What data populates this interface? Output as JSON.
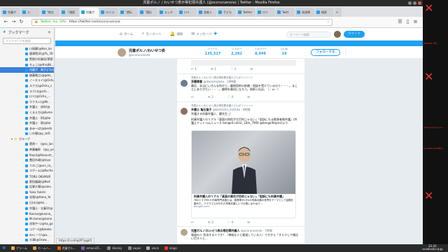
{
  "window": {
    "title": "児童ポルノ / わいせつ表示等犯罪弁護人 (@ocoruruenoia) | Twitter - Mozilla Firefox"
  },
  "tabs": [
    {
      "label": "児童ポ",
      "active": false
    },
    {
      "label": "ジ",
      "active": false
    },
    {
      "label": "\"地方",
      "active": false
    },
    {
      "label": "「顔面",
      "active": false
    },
    {
      "label": "児童ポ",
      "active": true
    },
    {
      "label": "ロリコ",
      "active": false
    },
    {
      "label": "\"遺伝",
      "active": false
    },
    {
      "label": "\"遺伝",
      "active": false
    },
    {
      "label": "エッチ",
      "active": false
    },
    {
      "label": "ロリ",
      "active": false
    },
    {
      "label": "芸能人",
      "active": false
    },
    {
      "label": "子ども",
      "active": false
    },
    {
      "label": "Twitter",
      "active": false
    },
    {
      "label": "ロリ",
      "active": false
    },
    {
      "label": "Twitt",
      "active": false
    },
    {
      "label": "発達障",
      "active": false
    },
    {
      "label": "検索",
      "active": false
    }
  ],
  "nav": {
    "back_icon": "arrow-left-icon",
    "forward_icon": "arrow-right-icon",
    "reload_icon": "reload-icon",
    "url_org": "Twitter, Inc. (US)",
    "url": "https://twitter.com/ocoruruenoia"
  },
  "sidebar": {
    "title": "ブックマーク",
    "search_placeholder": "ブックマークを検索",
    "items": [
      {
        "label": "川岡慶(@Ken_ka",
        "selected": false
      },
      {
        "label": "唐澤貴洋(@Ta_ Dt",
        "selected": false
      },
      {
        "label": "警察庁刑事局(警察",
        "selected": false
      },
      {
        "label": "ちょこ(@dhrqNl...",
        "selected": false
      },
      {
        "label": "児童ポ　岡子ども(@",
        "selected": true
      },
      {
        "label": "後藤雅之(@goto_",
        "selected": false
      },
      {
        "label": "ノースライ(@Ochu",
        "selected": false
      },
      {
        "label": "スクろ(@Ochu_s",
        "selected": false
      },
      {
        "label": "スクロ(@ichi...",
        "selected": false
      },
      {
        "label": "ロリ(@Ochu_...",
        "selected": false
      },
      {
        "label": "ホクスシ(@Mr...",
        "selected": false
      },
      {
        "label": "弁護士 · 成年(@",
        "selected": false
      },
      {
        "label": "くまえち(@Kuma",
        "selected": false
      },
      {
        "label": "弁護士 · 刑(@ba",
        "selected": false
      },
      {
        "label": "弁護士 · 敦(@ba",
        "selected": false
      },
      {
        "label": "あみーば(@beshi",
        "selected": false
      },
      {
        "label": "いわ猫(@y_iaIG",
        "selected": false
      }
    ],
    "group_label": "グループ",
    "group_items": [
      {
        "label": "菅原ー　(@ss_lan"
      },
      {
        "label": "斉藤義郎　(@y_ya"
      },
      {
        "label": "Kayo(@Kaeyum_"
      },
      {
        "label": "豊田市政(@toyo"
      },
      {
        "label": "うのこ(@uni_co_"
      },
      {
        "label": "ラボーム(@Kucha"
      },
      {
        "label": "TORU OKUMUR"
      },
      {
        "label": "野田議員(@Nod"
      },
      {
        "label": "記事大事(@suku"
      },
      {
        "label": "Yuka Yukimi"
      },
      {
        "label": "花咲(@Hana_Ya"
      },
      {
        "label": "日(の)@Hsi..."
      },
      {
        "label": "弁護士 · 五藤洋(@"
      },
      {
        "label": "Kanna(@kanna_"
      },
      {
        "label": "Mr.tomo(@tomo"
      },
      {
        "label": "花咲やへ(@ha_ga"
      },
      {
        "label": "コゲー(@Kokeke"
      },
      {
        "label": "aoくーり(@a..."
      },
      {
        "label": "大澤(@Osaw..."
      }
    ]
  },
  "twitter": {
    "nav": [
      {
        "icon": "home-icon",
        "label": "ホーム"
      },
      {
        "icon": "moments-icon",
        "label": "モーメント"
      },
      {
        "icon": "bell-icon",
        "label": "通知"
      },
      {
        "icon": "envelope-icon",
        "label": "メッセージ"
      }
    ],
    "search_placeholder": "キーワード検索",
    "tweet_button": "ツイート",
    "profile": {
      "name": "児童ポルノ/わいせつ表",
      "handle": "@ocoruruenoia",
      "stats": [
        {
          "label": "ツイート",
          "value": "135,517"
        },
        {
          "label": "フォロー",
          "value": "2,292"
        },
        {
          "label": "フォロワー",
          "value": "8,444"
        },
        {
          "label": "いいね",
          "value": "19"
        }
      ],
      "follow_button": "フォローする"
    },
    "tweets": [
      {
        "context": "",
        "name": "",
        "handle": "",
        "text": "",
        "actions": [
          "↩ 1",
          "⟲ 1",
          "♡ 1",
          "✉"
        ]
      },
      {
        "context": "児童ポルノ/わいせつ表示等犯罪弁護人さんがリツイート",
        "name": "茨薔薇曹",
        "handle": "@ibaramozaku · 18時間",
        "text": "最近、本当にいろんな所から、顧問契約の依頼・相談を受けているので・・・。まことにありがたい・・・。顧問を最初になろう。頑張らねば。（・ω・）",
        "actions": [
          "↩",
          "⟲ 2",
          "♡ 4",
          "✉"
        ]
      },
      {
        "context": "児童ポルノ/わいせつ表示等犯罪弁護人さんがリツイート",
        "name": "弁護士 亀石倫子",
        "handle": "@kameishi_michiko · 6時間",
        "text": "弁護する刑事弁護人、鍵先生📝",
        "text2": "刑事弁護人のリアル「裏面の負担が主目的じゃない」「起訴にもま推移者側弁護」(弁護士ドットコムニュース bengo4.com/c_18/n_7906 @bengo4topics)より",
        "card_title": "刑事弁護人のリアル「真面の責任が目的じゃない」「起訴にも刑事弁護」",
        "card_text": "TBSドラマ99.9 刑事専門弁護士は、無罪率99.9%の刑事弁護の世界をテーマとして話題を集めた。ドラマでえがかれた刑事弁護という仕事にはやはり...",
        "card_url": "bengo4.com",
        "actions": [
          "↩",
          "⟲ 3",
          "♡ 4",
          "✉"
        ]
      },
      {
        "context": "",
        "name": "児童ポルノ/わいせつ表示等犯罪弁護人",
        "handle": "@ocoruruenoia · 7時間",
        "text": "報道の人 判決する人です？（単純な人と報道している人）ですから「すぐ少しで報出い目す人と...",
        "actions": []
      }
    ],
    "status_url": "https://t.co/hq2P7ygpt5"
  },
  "taskbar": {
    "items": [
      {
        "label": "アラーム",
        "icon": "bell-icon"
      },
      {
        "label": "ホームへ...",
        "icon": "folder-icon"
      },
      {
        "label": "児童ポル...",
        "icon": "firefox-icon"
      },
      {
        "label": "emacs25...",
        "icon": "emacs-icon"
      },
      {
        "label": "blockiy",
        "icon": "window-icon"
      },
      {
        "label": "xapes",
        "icon": "window-icon"
      },
      {
        "label": "xlock",
        "icon": "lock-icon"
      },
      {
        "label": "xlogo",
        "icon": "x-icon"
      }
    ],
    "clock_time": "21:31",
    "clock_date": "2018年09月21日(金)"
  },
  "desktop": {
    "labels": [
      "emacs-28...",
      "stat-pin-guru-p-vs...",
      "2018年09月21日(金)",
      "pm2018-2018年(f)"
    ]
  }
}
